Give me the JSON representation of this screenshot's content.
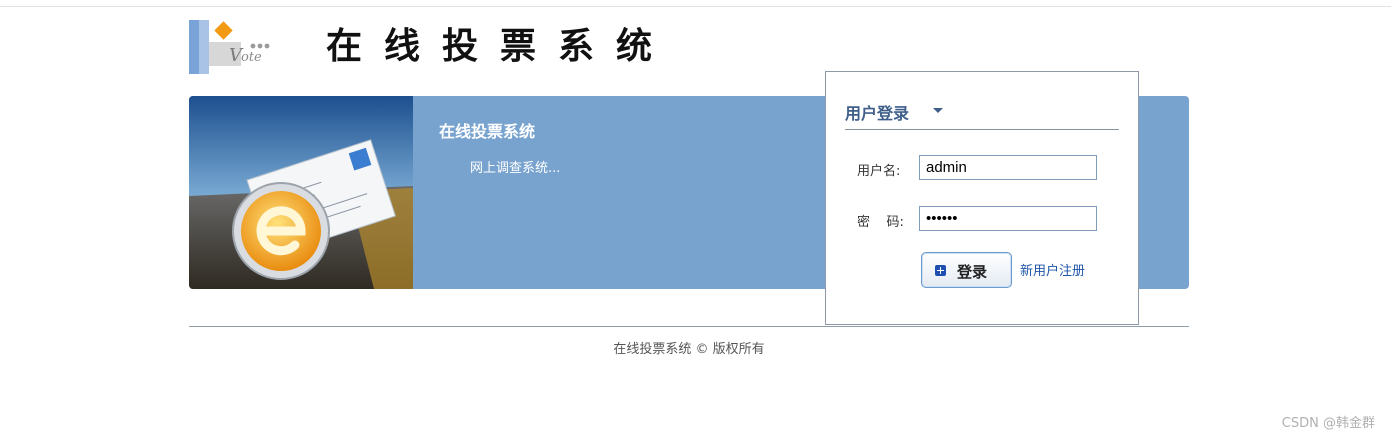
{
  "header": {
    "logo_text": "Vote",
    "site_title": "在线投票系统"
  },
  "banner": {
    "title": "在线投票系统",
    "subtitle": "网上调查系统..."
  },
  "login": {
    "title": "用户登录",
    "username_label": "用户名:",
    "username_value": "admin",
    "password_label": "密    码:",
    "password_value": "••••••",
    "login_button": "登录",
    "register_link": "新用户注册"
  },
  "footer": {
    "copyright": "在线投票系统 © 版权所有"
  },
  "watermark": "CSDN @韩金群",
  "colors": {
    "banner_bg": "#78a3cf",
    "panel_heading": "#3f5f8a",
    "link": "#1e55a8"
  }
}
